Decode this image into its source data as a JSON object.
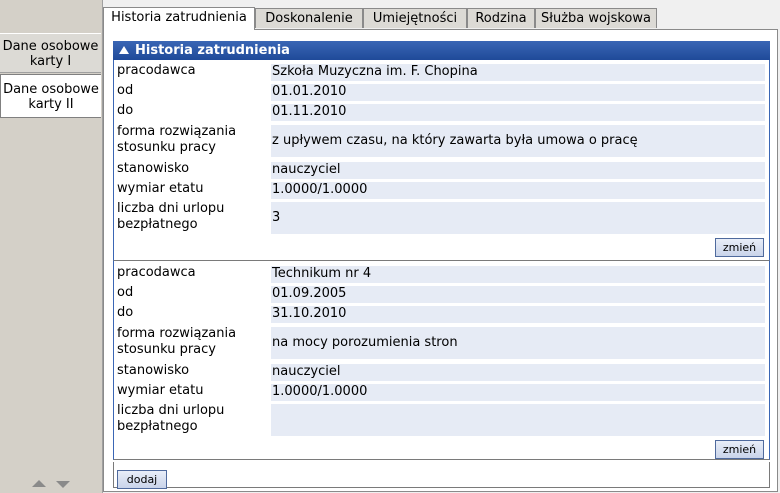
{
  "sidebar": {
    "items": [
      {
        "label_line1": "Dane osobowe",
        "label_line2": "karty I"
      },
      {
        "label_line1": "Dane osobowe",
        "label_line2": "karty II"
      }
    ]
  },
  "tabs": [
    {
      "label": "Historia zatrudnienia"
    },
    {
      "label": "Doskonalenie"
    },
    {
      "label": "Umiejętności"
    },
    {
      "label": "Rodzina"
    },
    {
      "label": "Służba wojskowa"
    }
  ],
  "section": {
    "title": "Historia zatrudnienia"
  },
  "labels": {
    "employer": "pracodawca",
    "from": "od",
    "to": "do",
    "termination_line1": "forma rozwiązania",
    "termination_line2": "stosunku pracy",
    "position": "stanowisko",
    "fte": "wymiar etatu",
    "unpaid_leave_line1": "liczba dni urlopu",
    "unpaid_leave_line2": "bezpłatnego"
  },
  "records": [
    {
      "employer": "Szkoła Muzyczna im. F. Chopina",
      "from": "01.01.2010",
      "to": "01.11.2010",
      "termination": "z upływem czasu, na który zawarta była umowa o pracę",
      "position": "nauczyciel",
      "fte": "1.0000/1.0000",
      "unpaid_leave_days": "3",
      "edit_label": "zmień"
    },
    {
      "employer": "Technikum nr 4",
      "from": "01.09.2005",
      "to": "31.10.2010",
      "termination": "na mocy porozumienia stron",
      "position": "nauczyciel",
      "fte": "1.0000/1.0000",
      "unpaid_leave_days": "",
      "edit_label": "zmień"
    }
  ],
  "add_label": "dodaj"
}
